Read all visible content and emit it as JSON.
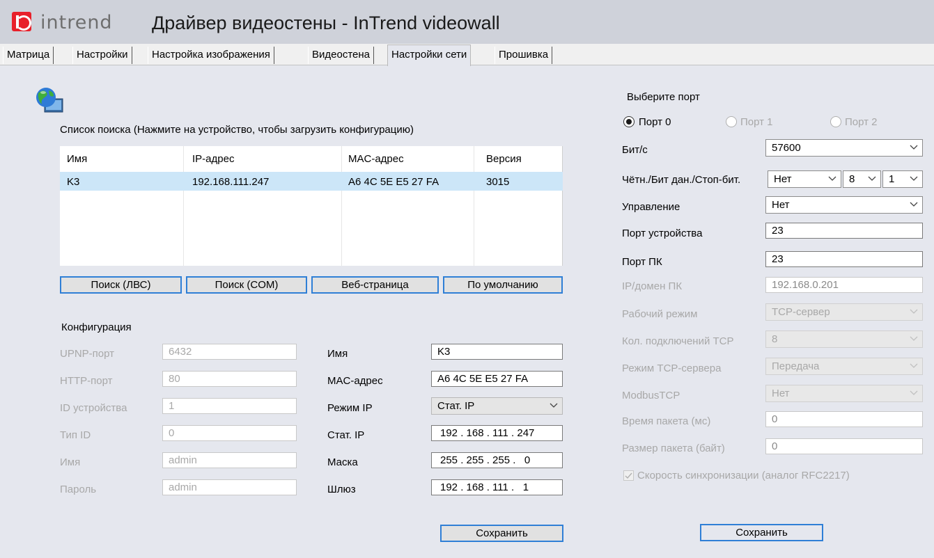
{
  "app": {
    "brand": "intrend",
    "title": "Драйвер видеостены - InTrend videowall"
  },
  "tabs": [
    "Матрица",
    "Настройки",
    "Настройка изображения",
    "Видеостена",
    "Настройки сети",
    "Прошивка"
  ],
  "search": {
    "title": "Список поиска (Нажмите на устройство, чтобы загрузить конфигурацию)",
    "columns": [
      "Имя",
      "IP-адрес",
      "MAC-адрес",
      "Версия"
    ],
    "rows": [
      [
        "K3",
        "192.168.111.247",
        "A6 4C 5E E5 27 FA",
        "3015"
      ]
    ],
    "buttons": [
      "Поиск (ЛВС)",
      "Поиск (COM)",
      "Веб-страница",
      "По умолчанию"
    ]
  },
  "config": {
    "title": "Конфигурация",
    "left": [
      {
        "label": "UPNP-порт",
        "value": "6432"
      },
      {
        "label": "HTTP-порт",
        "value": "80"
      },
      {
        "label": "ID устройства",
        "value": "1"
      },
      {
        "label": "Тип ID",
        "value": "0"
      },
      {
        "label": "Имя",
        "value": "admin"
      },
      {
        "label": "Пароль",
        "value": "admin"
      }
    ],
    "right": [
      {
        "label": "Имя",
        "value": "K3"
      },
      {
        "label": "MAC-адрес",
        "value": "A6 4C 5E E5 27 FA"
      },
      {
        "label": "Режим IP",
        "value": "Стат. IP"
      },
      {
        "label": "Стат. IP",
        "value": "192 . 168 . 111 . 247"
      },
      {
        "label": "Маска",
        "value": "255 . 255 . 255 .   0"
      },
      {
        "label": "Шлюз",
        "value": "192 . 168 . 111 .   1"
      }
    ],
    "save": "Сохранить"
  },
  "port": {
    "title": "Выберите порт",
    "radios": [
      "Порт 0",
      "Порт 1",
      "Порт 2"
    ],
    "fields": [
      {
        "label": "Бит/с",
        "value": "57600"
      },
      {
        "label": "Чётн./Бит дан./Стоп-бит.",
        "value": "Нет",
        "bits": "8",
        "stop": "1"
      },
      {
        "label": "Управление",
        "value": "Нет"
      },
      {
        "label": "Порт устройства",
        "value": "23"
      },
      {
        "label": "Порт ПК",
        "value": "23"
      },
      {
        "label": "IP/домен ПК",
        "value": "192.168.0.201"
      },
      {
        "label": "Рабочий режим",
        "value": "TCP-сервер"
      },
      {
        "label": "Кол. подключений TCP",
        "value": "8"
      },
      {
        "label": "Режим TCP-сервера",
        "value": "Передача"
      },
      {
        "label": "ModbusTCP",
        "value": "Нет"
      },
      {
        "label": "Время пакета (мс)",
        "value": "0"
      },
      {
        "label": "Размер пакета (байт)",
        "value": "0"
      }
    ],
    "sync": "Скорость синхронизации (аналог RFC2217)",
    "save": "Сохранить"
  }
}
